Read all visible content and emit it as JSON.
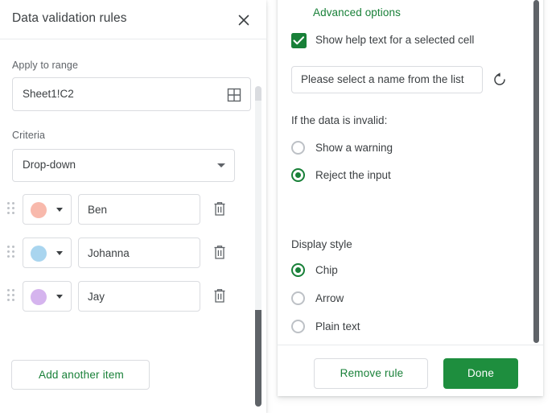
{
  "left_panel": {
    "title": "Data validation rules",
    "close_icon": "close-icon",
    "apply_to_range": {
      "label": "Apply to range",
      "value": "Sheet1!C2",
      "picker_icon": "grid-range-picker-icon"
    },
    "criteria": {
      "label": "Criteria",
      "selected": "Drop-down",
      "caret_icon": "chevron-down-icon"
    },
    "items": [
      {
        "color": "#F8B9AC",
        "value": "Ben",
        "drag_icon": "drag-handle-icon",
        "delete_icon": "trash-icon"
      },
      {
        "color": "#A9D5EF",
        "value": "Johanna",
        "drag_icon": "drag-handle-icon",
        "delete_icon": "trash-icon"
      },
      {
        "color": "#D5B4EE",
        "value": "Jay",
        "drag_icon": "drag-handle-icon",
        "delete_icon": "trash-icon"
      }
    ],
    "add_item_label": "Add another item"
  },
  "right_panel": {
    "advanced_options_title": "Advanced options",
    "show_help_text": {
      "label": "Show help text for a selected cell",
      "checked": true,
      "check_icon": "checkmark-icon"
    },
    "help_text": {
      "value": "Please select a name from the list",
      "reset_icon": "refresh-icon"
    },
    "invalid_data": {
      "label": "If the data is invalid:",
      "options": [
        {
          "label": "Show a warning",
          "selected": false
        },
        {
          "label": "Reject the input",
          "selected": true
        }
      ]
    },
    "display_style": {
      "label": "Display style",
      "options": [
        {
          "label": "Chip",
          "selected": true
        },
        {
          "label": "Arrow",
          "selected": false
        },
        {
          "label": "Plain text",
          "selected": false
        }
      ]
    },
    "remove_rule_label": "Remove rule",
    "done_label": "Done"
  },
  "colors": {
    "accent_green": "#188038",
    "done_button_green": "#1e8e3e",
    "text_primary": "#3c4043",
    "text_secondary": "#5f6368",
    "border": "#dadce0"
  }
}
